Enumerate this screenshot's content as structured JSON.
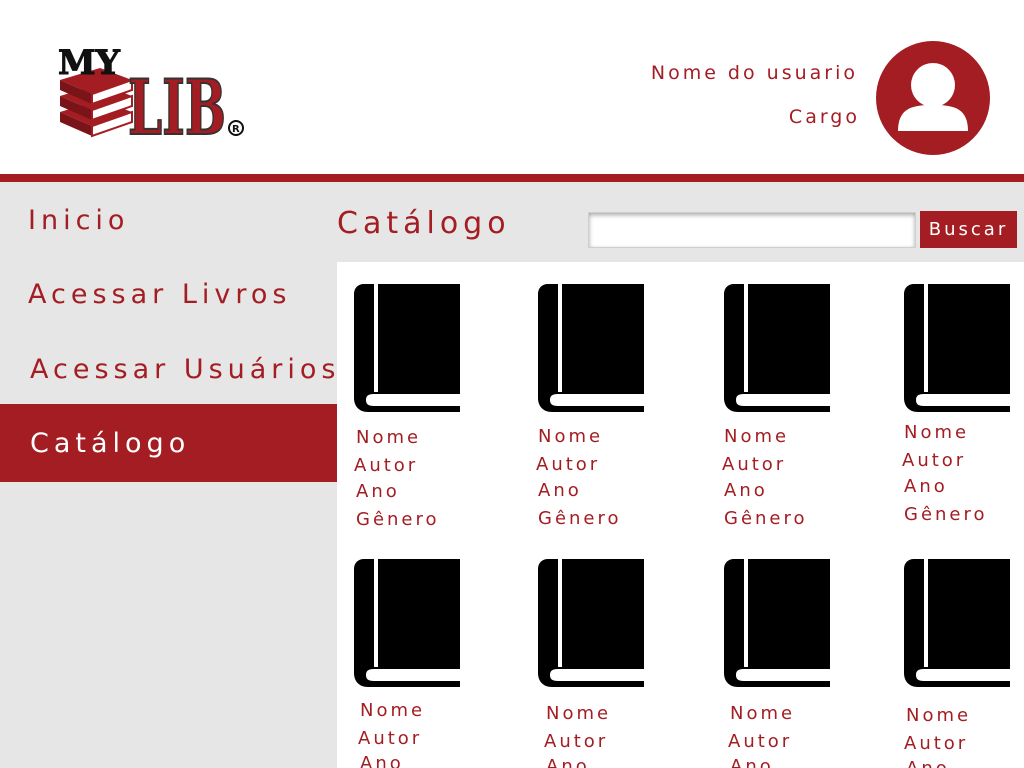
{
  "header": {
    "logo_text": "MY LIB",
    "user_name": "Nome do usuario",
    "user_role": "Cargo"
  },
  "sidebar": {
    "items": [
      {
        "label": "Inicio",
        "active": false
      },
      {
        "label": "Acessar Livros",
        "active": false
      },
      {
        "label": "Acessar Usuários",
        "active": false
      },
      {
        "label": "Catálogo",
        "active": true
      }
    ]
  },
  "main": {
    "title": "Catálogo",
    "search": {
      "value": "",
      "placeholder": ""
    },
    "search_button": "Buscar"
  },
  "books": [
    {
      "name": "Nome",
      "author": "Autor",
      "year": "Ano",
      "genre": "Gênero"
    },
    {
      "name": "Nome",
      "author": "Autor",
      "year": "Ano",
      "genre": "Gênero"
    },
    {
      "name": "Nome",
      "author": "Autor",
      "year": "Ano",
      "genre": "Gênero"
    },
    {
      "name": "Nome",
      "author": "Autor",
      "year": "Ano",
      "genre": "Gênero"
    },
    {
      "name": "Nome",
      "author": "Autor",
      "year": "Ano"
    },
    {
      "name": "Nome",
      "author": "Autor",
      "year": "Ano"
    },
    {
      "name": "Nome",
      "author": "Autor",
      "year": "Ano"
    },
    {
      "name": "Nome",
      "author": "Autor",
      "year": "Ano"
    }
  ],
  "colors": {
    "accent": "#a31d22",
    "panel": "#e6e6e6"
  }
}
